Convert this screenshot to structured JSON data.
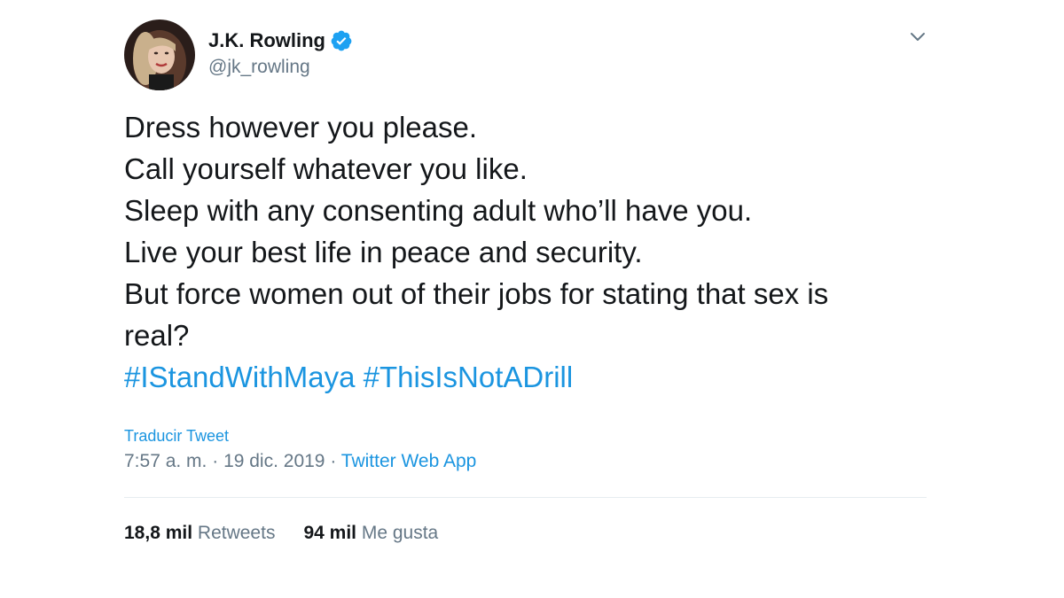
{
  "author": {
    "display_name": "J.K. Rowling",
    "handle": "@jk_rowling",
    "verified": true,
    "verified_color": "#1da1f2"
  },
  "tweet": {
    "lines": [
      "Dress however you please.",
      "Call yourself whatever you like.",
      "Sleep with any consenting adult who’ll have you.",
      "Live your best life in peace and security.",
      "But force women out of their jobs for stating that sex is",
      "real?"
    ],
    "hashtags": [
      "#IStandWithMaya",
      "#ThisIsNotADrill"
    ]
  },
  "translate_label": "Traducir Tweet",
  "meta": {
    "time": "7:57 a. m.",
    "separator": " · ",
    "date": "19 dic. 2019",
    "source": "Twitter Web App"
  },
  "stats": {
    "retweets_count": "18,8 mil",
    "retweets_label": "Retweets",
    "likes_count": "94 mil",
    "likes_label": "Me gusta"
  },
  "colors": {
    "link": "#1b95e0",
    "secondary_text": "#657786",
    "primary_text": "#14171a",
    "divider": "#e6ecf0"
  },
  "icons": {
    "verified": "verified-badge-icon",
    "caret": "chevron-down-icon"
  }
}
